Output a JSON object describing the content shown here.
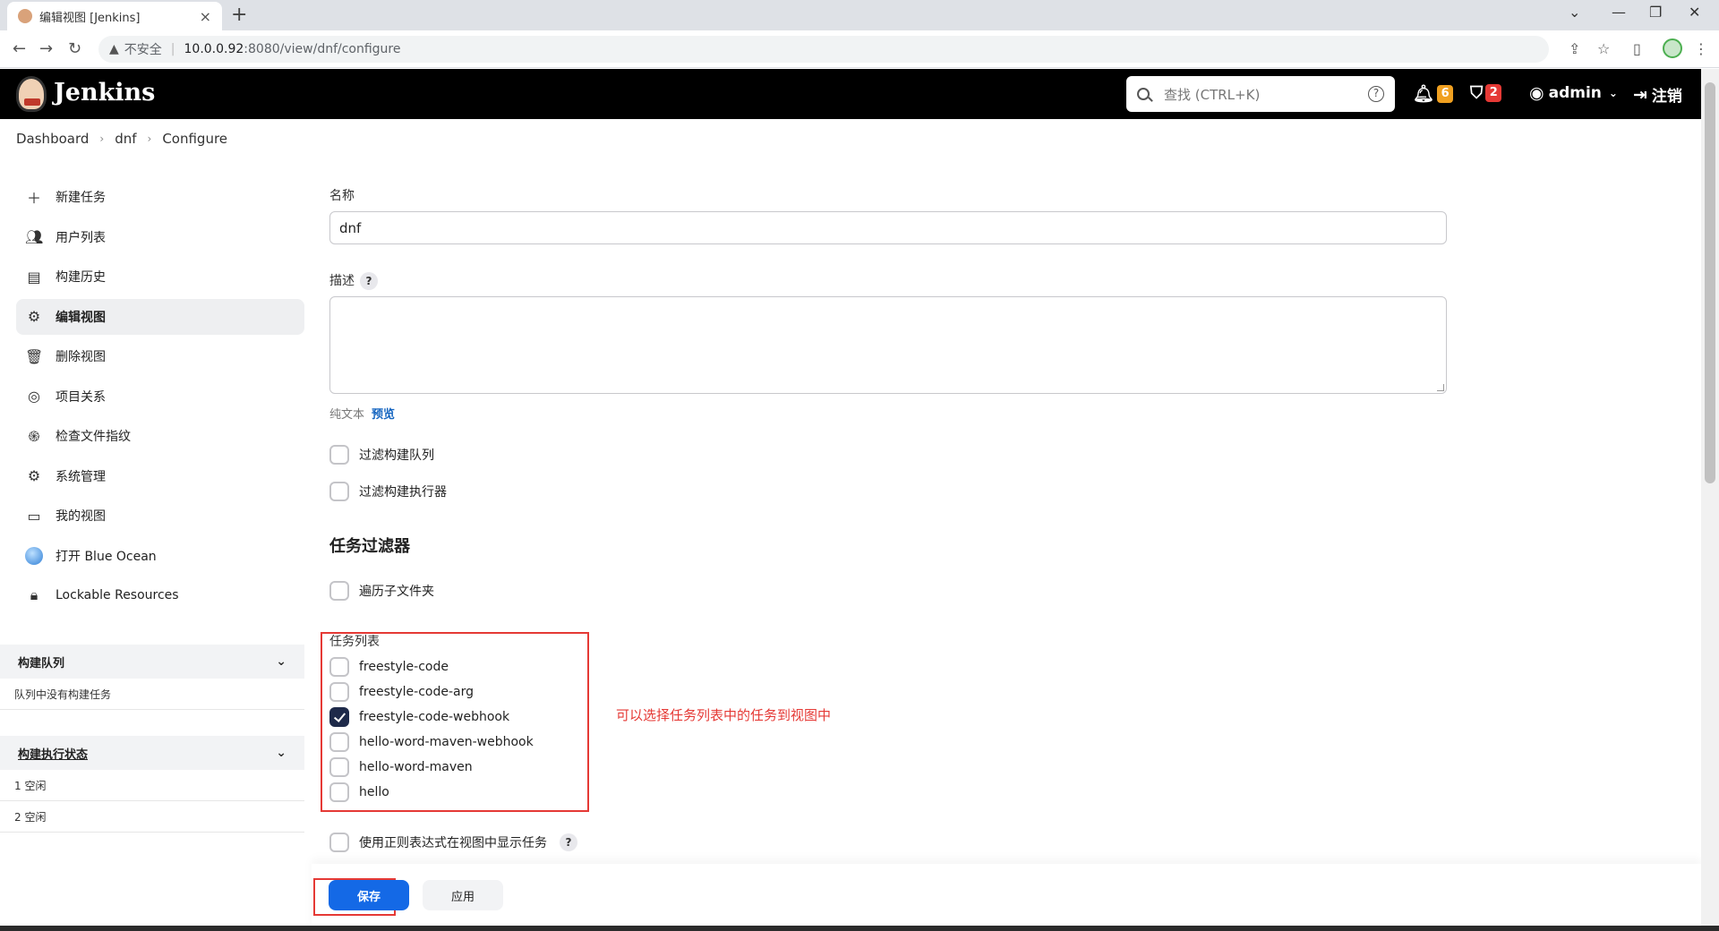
{
  "browser": {
    "tab_title": "编辑视图 [Jenkins]",
    "tab_close": "×",
    "new_tab": "+",
    "insecure_label": "不安全",
    "url_host": "10.0.0.92",
    "url_path": ":8080/view/dnf/configure",
    "controls": {
      "min": "⌄",
      "minimize": "—",
      "restore": "❐",
      "close": "✕"
    }
  },
  "header": {
    "title": "Jenkins",
    "search_placeholder": "查找 (CTRL+K)",
    "search_help": "?",
    "notifications_count": "6",
    "security_count": "2",
    "user": "admin",
    "logout": "注销"
  },
  "breadcrumb": [
    "Dashboard",
    "dnf",
    "Configure"
  ],
  "sidebar": {
    "items": [
      {
        "label": "新建任务",
        "icon": "plus-icon"
      },
      {
        "label": "用户列表",
        "icon": "users-icon"
      },
      {
        "label": "构建历史",
        "icon": "history-icon"
      },
      {
        "label": "编辑视图",
        "icon": "gear-icon"
      },
      {
        "label": "删除视图",
        "icon": "trash-icon"
      },
      {
        "label": "项目关系",
        "icon": "relation-icon"
      },
      {
        "label": "检查文件指纹",
        "icon": "fingerprint-icon"
      },
      {
        "label": "系统管理",
        "icon": "gear-icon"
      },
      {
        "label": "我的视图",
        "icon": "window-icon"
      },
      {
        "label": "打开 Blue Ocean",
        "icon": "blue-ocean-icon"
      },
      {
        "label": "Lockable Resources",
        "icon": "lock-icon"
      }
    ],
    "queue": {
      "title": "构建队列",
      "empty": "队列中没有构建任务"
    },
    "executors": {
      "title": "构建执行状态",
      "rows": [
        "1  空闲",
        "2  空闲"
      ]
    }
  },
  "form": {
    "name_label": "名称",
    "name_value": "dnf",
    "desc_label": "描述",
    "desc_help": "?",
    "plain_text": "纯文本",
    "preview": "预览",
    "filter_queue": "过滤构建队列",
    "filter_executors": "过滤构建执行器",
    "job_filter_title": "任务过滤器",
    "recurse": "遍历子文件夹",
    "jobs_label": "任务列表",
    "jobs": [
      {
        "name": "freestyle-code",
        "checked": false
      },
      {
        "name": "freestyle-code-arg",
        "checked": false
      },
      {
        "name": "freestyle-code-webhook",
        "checked": true
      },
      {
        "name": "hello-word-maven-webhook",
        "checked": false
      },
      {
        "name": "hello-word-maven",
        "checked": false
      },
      {
        "name": "hello",
        "checked": false
      }
    ],
    "annotation": "可以选择任务列表中的任务到视图中",
    "regex": "使用正则表达式在视图中显示任务",
    "regex_help": "?",
    "save": "保存",
    "apply": "应用"
  },
  "colors": {
    "accent": "#1469e6",
    "annotation": "#e53935",
    "header": "#000000"
  }
}
